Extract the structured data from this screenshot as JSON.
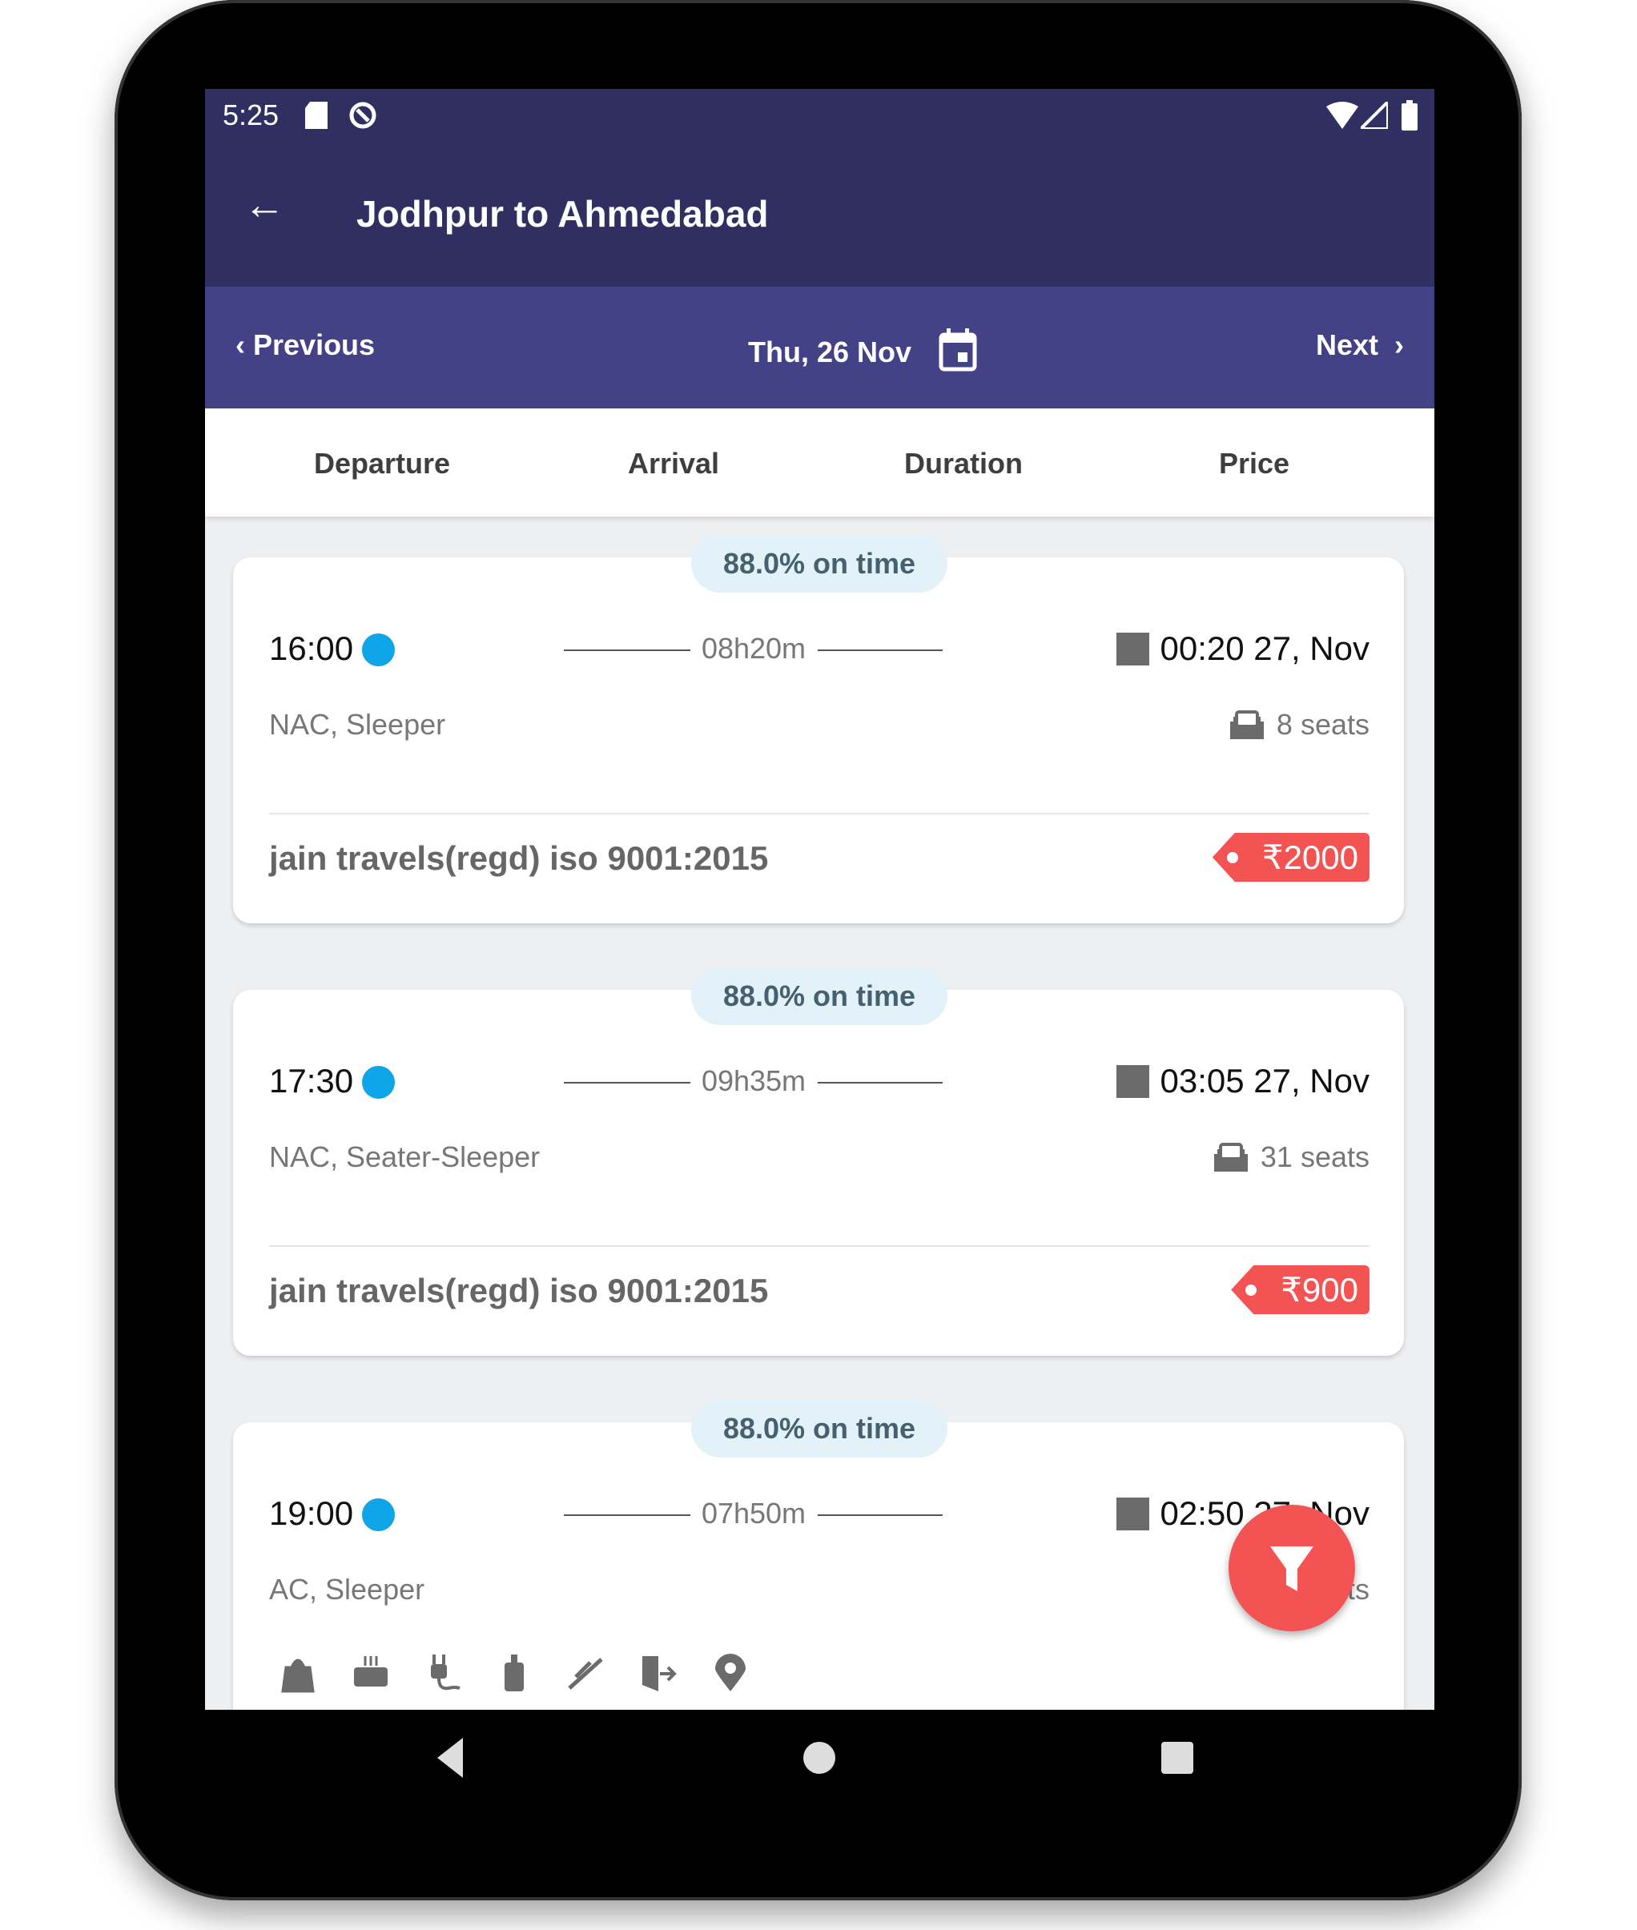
{
  "status_bar": {
    "time": "5:25"
  },
  "app_bar": {
    "title": "Jodhpur to Ahmedabad"
  },
  "date_bar": {
    "previous": "Previous",
    "date": "Thu, 26 Nov",
    "next": "Next"
  },
  "sort_tabs": [
    "Departure",
    "Arrival",
    "Duration",
    "Price"
  ],
  "colors": {
    "primary_dark": "#312f62",
    "primary": "#434286",
    "accent": "#f45353",
    "dot": "#0ea5e9"
  },
  "buses": [
    {
      "on_time": "88.0% on time",
      "departure": "16:00",
      "duration": "08h20m",
      "arrival": "00:20 27, Nov",
      "type": "NAC, Sleeper",
      "seats": "8 seats",
      "operator": "jain travels(regd) iso 9001:2015",
      "price": "₹2000"
    },
    {
      "on_time": "88.0% on time",
      "departure": "17:30",
      "duration": "09h35m",
      "arrival": "03:05 27, Nov",
      "type": "NAC, Seater-Sleeper",
      "seats": "31 seats",
      "operator": "jain travels(regd) iso 9001:2015",
      "price": "₹900"
    },
    {
      "on_time": "88.0% on time",
      "departure": "19:00",
      "duration": "07h50m",
      "arrival": "02:50 27, Nov",
      "type": "AC, Sleeper",
      "seats": "seats",
      "amenities": [
        "bag-icon",
        "blanket-icon",
        "charging-point-icon",
        "water-bottle-icon",
        "reading-light-icon",
        "emergency-exit-icon",
        "gps-tracking-icon"
      ]
    }
  ]
}
